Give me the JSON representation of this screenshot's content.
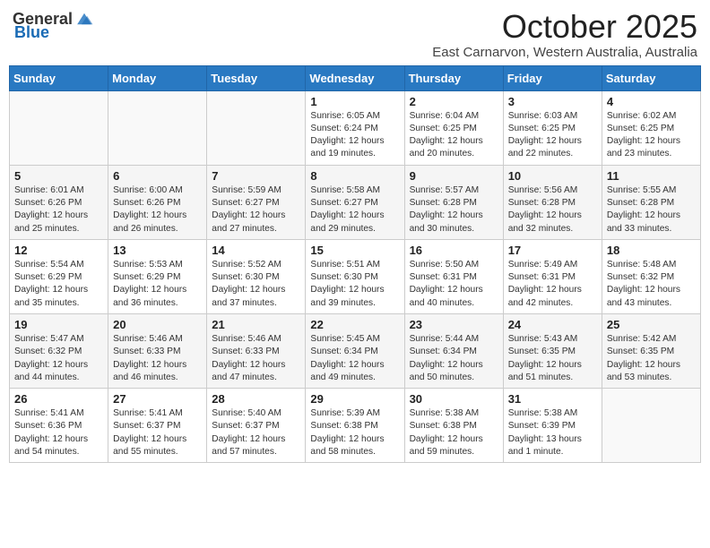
{
  "header": {
    "logo_general": "General",
    "logo_blue": "Blue",
    "month": "October 2025",
    "location": "East Carnarvon, Western Australia, Australia"
  },
  "weekdays": [
    "Sunday",
    "Monday",
    "Tuesday",
    "Wednesday",
    "Thursday",
    "Friday",
    "Saturday"
  ],
  "weeks": [
    [
      {
        "day": "",
        "info": ""
      },
      {
        "day": "",
        "info": ""
      },
      {
        "day": "",
        "info": ""
      },
      {
        "day": "1",
        "info": "Sunrise: 6:05 AM\nSunset: 6:24 PM\nDaylight: 12 hours\nand 19 minutes."
      },
      {
        "day": "2",
        "info": "Sunrise: 6:04 AM\nSunset: 6:25 PM\nDaylight: 12 hours\nand 20 minutes."
      },
      {
        "day": "3",
        "info": "Sunrise: 6:03 AM\nSunset: 6:25 PM\nDaylight: 12 hours\nand 22 minutes."
      },
      {
        "day": "4",
        "info": "Sunrise: 6:02 AM\nSunset: 6:25 PM\nDaylight: 12 hours\nand 23 minutes."
      }
    ],
    [
      {
        "day": "5",
        "info": "Sunrise: 6:01 AM\nSunset: 6:26 PM\nDaylight: 12 hours\nand 25 minutes."
      },
      {
        "day": "6",
        "info": "Sunrise: 6:00 AM\nSunset: 6:26 PM\nDaylight: 12 hours\nand 26 minutes."
      },
      {
        "day": "7",
        "info": "Sunrise: 5:59 AM\nSunset: 6:27 PM\nDaylight: 12 hours\nand 27 minutes."
      },
      {
        "day": "8",
        "info": "Sunrise: 5:58 AM\nSunset: 6:27 PM\nDaylight: 12 hours\nand 29 minutes."
      },
      {
        "day": "9",
        "info": "Sunrise: 5:57 AM\nSunset: 6:28 PM\nDaylight: 12 hours\nand 30 minutes."
      },
      {
        "day": "10",
        "info": "Sunrise: 5:56 AM\nSunset: 6:28 PM\nDaylight: 12 hours\nand 32 minutes."
      },
      {
        "day": "11",
        "info": "Sunrise: 5:55 AM\nSunset: 6:28 PM\nDaylight: 12 hours\nand 33 minutes."
      }
    ],
    [
      {
        "day": "12",
        "info": "Sunrise: 5:54 AM\nSunset: 6:29 PM\nDaylight: 12 hours\nand 35 minutes."
      },
      {
        "day": "13",
        "info": "Sunrise: 5:53 AM\nSunset: 6:29 PM\nDaylight: 12 hours\nand 36 minutes."
      },
      {
        "day": "14",
        "info": "Sunrise: 5:52 AM\nSunset: 6:30 PM\nDaylight: 12 hours\nand 37 minutes."
      },
      {
        "day": "15",
        "info": "Sunrise: 5:51 AM\nSunset: 6:30 PM\nDaylight: 12 hours\nand 39 minutes."
      },
      {
        "day": "16",
        "info": "Sunrise: 5:50 AM\nSunset: 6:31 PM\nDaylight: 12 hours\nand 40 minutes."
      },
      {
        "day": "17",
        "info": "Sunrise: 5:49 AM\nSunset: 6:31 PM\nDaylight: 12 hours\nand 42 minutes."
      },
      {
        "day": "18",
        "info": "Sunrise: 5:48 AM\nSunset: 6:32 PM\nDaylight: 12 hours\nand 43 minutes."
      }
    ],
    [
      {
        "day": "19",
        "info": "Sunrise: 5:47 AM\nSunset: 6:32 PM\nDaylight: 12 hours\nand 44 minutes."
      },
      {
        "day": "20",
        "info": "Sunrise: 5:46 AM\nSunset: 6:33 PM\nDaylight: 12 hours\nand 46 minutes."
      },
      {
        "day": "21",
        "info": "Sunrise: 5:46 AM\nSunset: 6:33 PM\nDaylight: 12 hours\nand 47 minutes."
      },
      {
        "day": "22",
        "info": "Sunrise: 5:45 AM\nSunset: 6:34 PM\nDaylight: 12 hours\nand 49 minutes."
      },
      {
        "day": "23",
        "info": "Sunrise: 5:44 AM\nSunset: 6:34 PM\nDaylight: 12 hours\nand 50 minutes."
      },
      {
        "day": "24",
        "info": "Sunrise: 5:43 AM\nSunset: 6:35 PM\nDaylight: 12 hours\nand 51 minutes."
      },
      {
        "day": "25",
        "info": "Sunrise: 5:42 AM\nSunset: 6:35 PM\nDaylight: 12 hours\nand 53 minutes."
      }
    ],
    [
      {
        "day": "26",
        "info": "Sunrise: 5:41 AM\nSunset: 6:36 PM\nDaylight: 12 hours\nand 54 minutes."
      },
      {
        "day": "27",
        "info": "Sunrise: 5:41 AM\nSunset: 6:37 PM\nDaylight: 12 hours\nand 55 minutes."
      },
      {
        "day": "28",
        "info": "Sunrise: 5:40 AM\nSunset: 6:37 PM\nDaylight: 12 hours\nand 57 minutes."
      },
      {
        "day": "29",
        "info": "Sunrise: 5:39 AM\nSunset: 6:38 PM\nDaylight: 12 hours\nand 58 minutes."
      },
      {
        "day": "30",
        "info": "Sunrise: 5:38 AM\nSunset: 6:38 PM\nDaylight: 12 hours\nand 59 minutes."
      },
      {
        "day": "31",
        "info": "Sunrise: 5:38 AM\nSunset: 6:39 PM\nDaylight: 13 hours\nand 1 minute."
      },
      {
        "day": "",
        "info": ""
      }
    ]
  ]
}
